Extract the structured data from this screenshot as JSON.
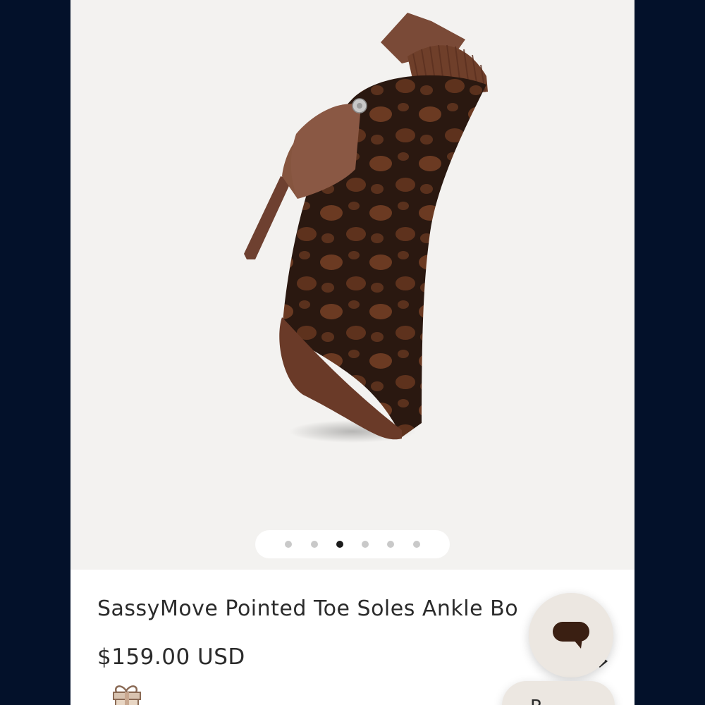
{
  "product": {
    "image_alt": "Brown snakeskin knit pointed toe stiletto ankle boot",
    "title": "SassyMove Pointed Toe Soles Ankle Bo",
    "price": "$159.00 USD"
  },
  "gallery": {
    "dot_count": 6,
    "active_index": 2
  },
  "floating": {
    "chat_icon": "chat-bubble-icon",
    "pill_label": "R"
  },
  "colors": {
    "frame": "#03112a",
    "gallery_bg": "#f3f2f0",
    "leather": "#7a4a37",
    "knit_dark": "#2a1810",
    "knit_light": "#6b3a22",
    "bubble": "#ece7e1"
  }
}
